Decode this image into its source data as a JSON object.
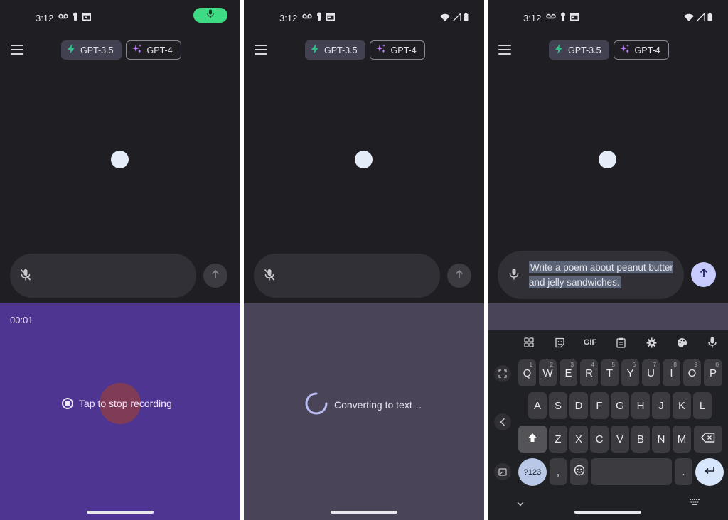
{
  "status": {
    "time": "3:12"
  },
  "models": {
    "gpt35": "GPT-3.5",
    "gpt4": "GPT-4"
  },
  "recording": {
    "timer": "00:01",
    "stop_label": "Tap to stop recording"
  },
  "converting": {
    "label": "Converting to text…"
  },
  "compose": {
    "text": "Write a poem about peanut butter and jelly sandwiches."
  },
  "keyboard": {
    "toolbar": [
      "apps",
      "sticker",
      "GIF",
      "clipboard",
      "settings",
      "palette",
      "mic"
    ],
    "row1": [
      {
        "key": "Q",
        "hint": "1"
      },
      {
        "key": "W",
        "hint": "2"
      },
      {
        "key": "E",
        "hint": "3"
      },
      {
        "key": "R",
        "hint": "4"
      },
      {
        "key": "T",
        "hint": "5"
      },
      {
        "key": "Y",
        "hint": "6"
      },
      {
        "key": "U",
        "hint": "7"
      },
      {
        "key": "I",
        "hint": "8"
      },
      {
        "key": "O",
        "hint": "9"
      },
      {
        "key": "P",
        "hint": "0"
      }
    ],
    "row2": [
      "A",
      "S",
      "D",
      "F",
      "G",
      "H",
      "J",
      "K",
      "L"
    ],
    "row3": [
      "Z",
      "X",
      "C",
      "V",
      "B",
      "N",
      "M"
    ],
    "symbols_label": "?123",
    "comma": ",",
    "period": "."
  },
  "colors": {
    "background": "#1f1f23",
    "recording_bg": "#4e3591",
    "converting_bg": "#4a4458",
    "accent_green": "#3ddc84",
    "send_active": "#c7cbff"
  }
}
